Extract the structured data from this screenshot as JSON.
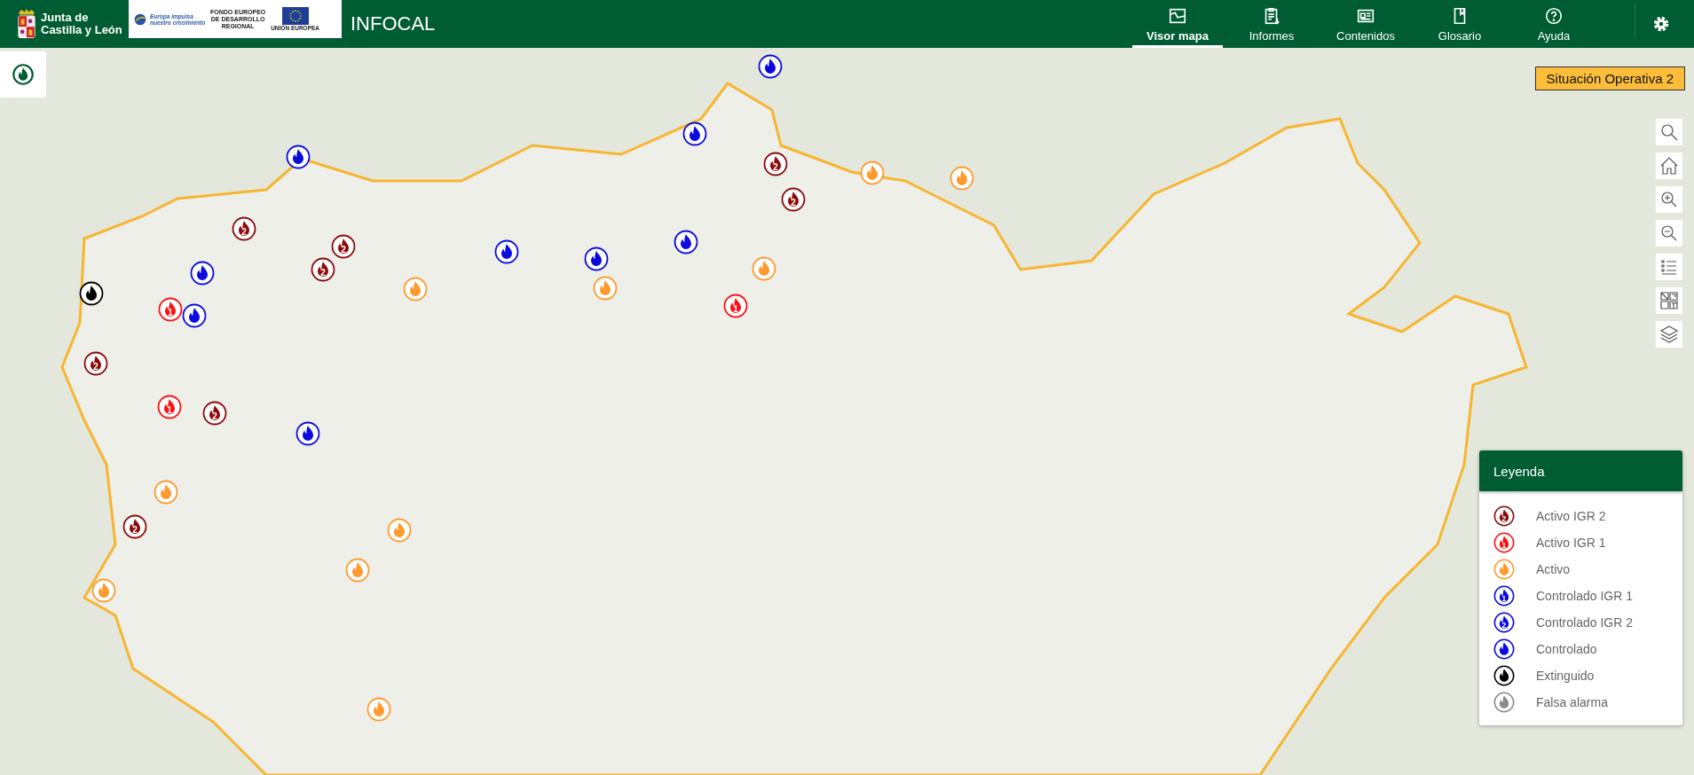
{
  "header": {
    "logo_lines": [
      "Junta de",
      "Castilla y León"
    ],
    "eu_banner": {
      "slogan_lines": [
        "Europa impulsa",
        "nuestro crecimiento"
      ],
      "fund": "FONDO EUROPEO DE DESARROLLO REGIONAL",
      "union": "UNIÓN EUROPEA"
    },
    "title": "INFOCAL",
    "nav": [
      {
        "kind": "map",
        "label": "Visor mapa",
        "selected": true
      },
      {
        "kind": "reports",
        "label": "Informes",
        "selected": false
      },
      {
        "kind": "contents",
        "label": "Contenidos",
        "selected": false
      },
      {
        "kind": "glossary",
        "label": "Glosario",
        "selected": false
      },
      {
        "kind": "help",
        "label": "Ayuda",
        "selected": false
      }
    ]
  },
  "situation": "Situación Operativa 2",
  "tools": [
    {
      "kind": "search"
    },
    {
      "kind": "home"
    },
    {
      "kind": "zoom-in"
    },
    {
      "kind": "zoom-out"
    },
    {
      "kind": "list"
    },
    {
      "kind": "basemap"
    },
    {
      "kind": "layers"
    }
  ],
  "markers": [
    {
      "kind": "controlado"
    },
    {
      "kind": "controlado"
    },
    {
      "kind": "controlado"
    },
    {
      "kind": "igr2",
      "badge": "2"
    },
    {
      "kind": "activo"
    },
    {
      "kind": "activo"
    },
    {
      "kind": "igr2",
      "badge": "2"
    },
    {
      "kind": "igr2",
      "badge": "2"
    },
    {
      "kind": "igr2",
      "badge": "2"
    },
    {
      "kind": "igr2",
      "badge": "2"
    },
    {
      "kind": "controlado"
    },
    {
      "kind": "controlado"
    },
    {
      "kind": "controlado"
    },
    {
      "kind": "controlado"
    },
    {
      "kind": "activo"
    },
    {
      "kind": "activo"
    },
    {
      "kind": "activo"
    },
    {
      "kind": "extinguido"
    },
    {
      "kind": "igr1",
      "badge": "1"
    },
    {
      "kind": "controlado"
    },
    {
      "kind": "igr1",
      "badge": "1"
    },
    {
      "kind": "igr2",
      "badge": "2"
    },
    {
      "kind": "igr1",
      "badge": "1"
    },
    {
      "kind": "igr2",
      "badge": "2"
    },
    {
      "kind": "controlado"
    },
    {
      "kind": "activo"
    },
    {
      "kind": "igr2",
      "badge": "2"
    },
    {
      "kind": "activo"
    },
    {
      "kind": "activo"
    },
    {
      "kind": "activo"
    },
    {
      "kind": "activo"
    }
  ],
  "legend": {
    "title": "Leyenda",
    "items": [
      {
        "kind": "igr2",
        "badge": "2",
        "label": "Activo IGR 2"
      },
      {
        "kind": "igr1",
        "badge": "1",
        "label": "Activo IGR 1"
      },
      {
        "kind": "activo",
        "label": "Activo"
      },
      {
        "kind": "ctrl1",
        "badge": "1",
        "label": "Controlado IGR 1"
      },
      {
        "kind": "ctrl2",
        "badge": "2",
        "label": "Controlado IGR 2"
      },
      {
        "kind": "controlado",
        "label": "Controlado"
      },
      {
        "kind": "extinguido",
        "label": "Extinguido"
      },
      {
        "kind": "falsa",
        "label": "Falsa alarma"
      }
    ]
  }
}
